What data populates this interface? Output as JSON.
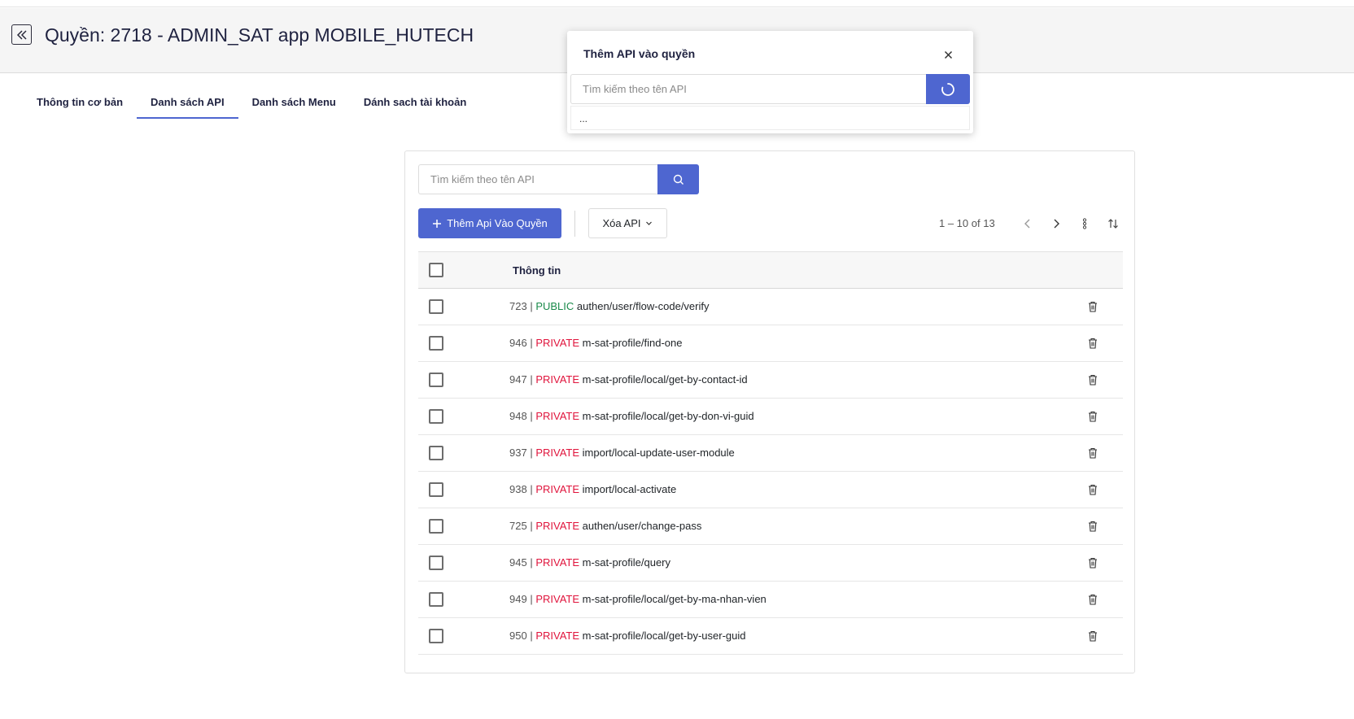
{
  "header": {
    "title": "Quyền: 2718 - ADMIN_SAT app MOBILE_HUTECH"
  },
  "tabs": [
    {
      "label": "Thông tin cơ bản",
      "active": false
    },
    {
      "label": "Danh sách API",
      "active": true
    },
    {
      "label": "Danh sách Menu",
      "active": false
    },
    {
      "label": "Dánh sach tài khoản",
      "active": false
    }
  ],
  "search": {
    "placeholder": "Tìm kiếm theo tên API"
  },
  "toolbar": {
    "add_label": "Thêm Api Vào Quyền",
    "delete_label": "Xóa API",
    "pager": "1 – 10 of 13"
  },
  "table": {
    "column_header": "Thông tin",
    "rows": [
      {
        "id": "723",
        "scope": "PUBLIC",
        "path": "authen/user/flow-code/verify"
      },
      {
        "id": "946",
        "scope": "PRIVATE",
        "path": "m-sat-profile/find-one"
      },
      {
        "id": "947",
        "scope": "PRIVATE",
        "path": "m-sat-profile/local/get-by-contact-id"
      },
      {
        "id": "948",
        "scope": "PRIVATE",
        "path": "m-sat-profile/local/get-by-don-vi-guid"
      },
      {
        "id": "937",
        "scope": "PRIVATE",
        "path": "import/local-update-user-module"
      },
      {
        "id": "938",
        "scope": "PRIVATE",
        "path": "import/local-activate"
      },
      {
        "id": "725",
        "scope": "PRIVATE",
        "path": "authen/user/change-pass"
      },
      {
        "id": "945",
        "scope": "PRIVATE",
        "path": "m-sat-profile/query"
      },
      {
        "id": "949",
        "scope": "PRIVATE",
        "path": "m-sat-profile/local/get-by-ma-nhan-vien"
      },
      {
        "id": "950",
        "scope": "PRIVATE",
        "path": "m-sat-profile/local/get-by-user-guid"
      }
    ]
  },
  "modal": {
    "title": "Thêm API vào quyền",
    "placeholder": "Tìm kiếm theo tên API",
    "result_text": "..."
  },
  "colors": {
    "primary": "#4e66d0",
    "public": "#1a8a4a",
    "private": "#e0143c"
  }
}
